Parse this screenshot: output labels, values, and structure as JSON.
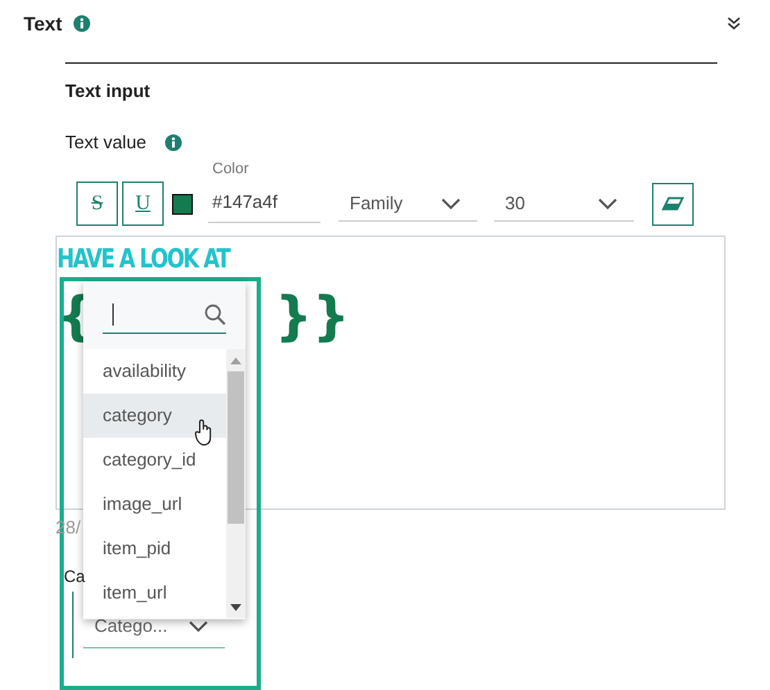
{
  "section": {
    "title": "Text",
    "expanded": true
  },
  "subsection": {
    "title": "Text input"
  },
  "field_label": "Text value",
  "toolbar": {
    "strike": "S",
    "underline": "U",
    "color_label": "Color",
    "color_value": "#147a4f",
    "color": "#147a4f",
    "family": "Family",
    "size": "30"
  },
  "editor": {
    "line_1": "HAVE A LOOK AT",
    "line_2_start": "{",
    "line_2_end": "}}"
  },
  "counter": "28/",
  "category_label": "Ca",
  "category_select": "Catego...",
  "popup": {
    "items": [
      {
        "label": "availability",
        "hovered": false
      },
      {
        "label": "category",
        "hovered": true
      },
      {
        "label": "category_id",
        "hovered": false
      },
      {
        "label": "image_url",
        "hovered": false
      },
      {
        "label": "item_pid",
        "hovered": false
      },
      {
        "label": "item_url",
        "hovered": false
      }
    ]
  }
}
